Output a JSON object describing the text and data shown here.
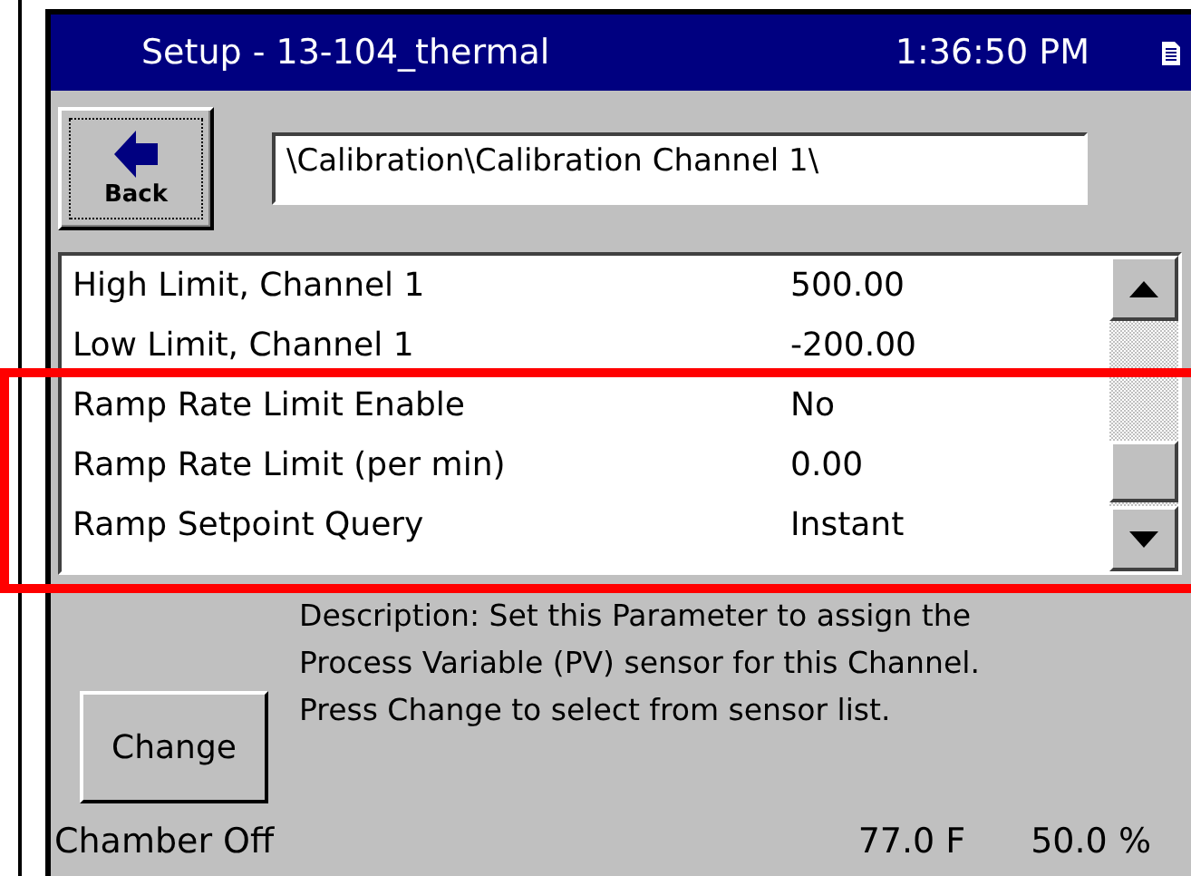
{
  "window": {
    "title": "Setup - 13-104_thermal",
    "time": "1:36:50 PM"
  },
  "toolbar": {
    "back_button": "Back",
    "path": "\\Calibration\\Calibration Channel 1\\"
  },
  "parameters": [
    {
      "name": "High Limit, Channel 1",
      "value": "500.00"
    },
    {
      "name": "Low Limit, Channel 1",
      "value": "-200.00"
    },
    {
      "name": "Ramp Rate Limit Enable",
      "value": "No"
    },
    {
      "name": "Ramp Rate Limit (per min)",
      "value": "0.00"
    },
    {
      "name": "Ramp Setpoint Query",
      "value": "Instant"
    }
  ],
  "description": [
    "Description:  Set this Parameter to assign the",
    "Process Variable (PV) sensor for this Channel.",
    "Press Change to select from sensor list."
  ],
  "change_button": "Change",
  "status_bar": {
    "state": "Chamber Off",
    "temperature": "77.0 F",
    "humidity": "50.0 %"
  }
}
